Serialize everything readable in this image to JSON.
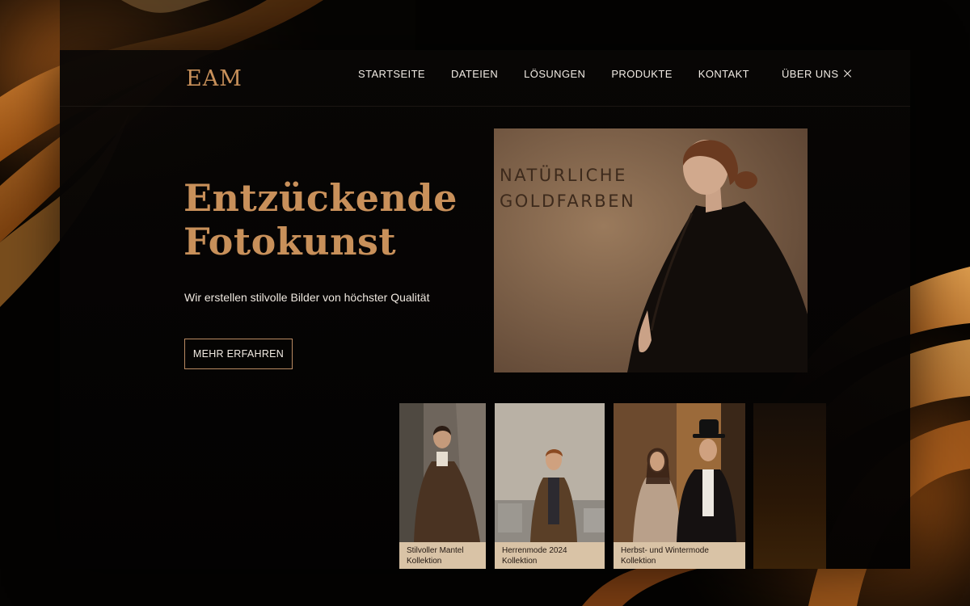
{
  "brand": {
    "logo": "EAM"
  },
  "nav": {
    "items": [
      {
        "label": "STARTSEITE"
      },
      {
        "label": "DATEIEN"
      },
      {
        "label": "LÖSUNGEN"
      },
      {
        "label": "PRODUKTE"
      },
      {
        "label": "KONTAKT"
      },
      {
        "label": "ÜBER UNS",
        "icon": "close-icon"
      }
    ]
  },
  "hero": {
    "title_line1": "Entzückende",
    "title_line2": "Fotokunst",
    "subtitle": "Wir erstellen stilvolle Bilder von höchster Qualität",
    "cta_label": "MEHR ERFAHREN"
  },
  "feature": {
    "caption_line1": "NATÜRLICHE",
    "caption_line2": "GOLDFARBEN"
  },
  "collections": [
    {
      "line1": "Stilvoller Mantel",
      "line2": "Kollektion"
    },
    {
      "line1": "Herrenmode 2024",
      "line2": "Kollektion"
    },
    {
      "line1": "Herbst- und Wintermode",
      "line2": "Kollektion"
    }
  ],
  "colors": {
    "accent_gold": "#c8905a",
    "background": "#040302",
    "card_label_bg": "#d9c3a6"
  }
}
